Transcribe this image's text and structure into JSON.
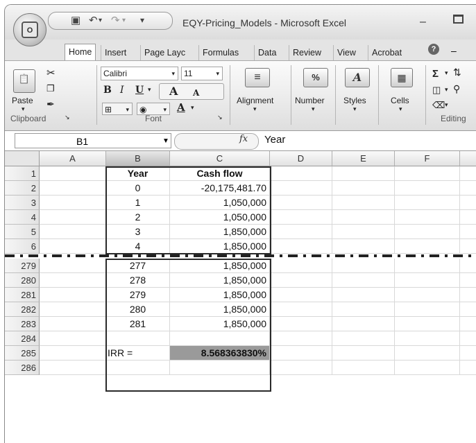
{
  "window": {
    "title": "EQY-Pricing_Models - Microsoft Excel",
    "office_logo_text": "O",
    "qat_icons": [
      "save-icon",
      "undo-icon",
      "redo-icon",
      "customize-icon"
    ]
  },
  "tabs": [
    "Home",
    "Insert",
    "Page Layc",
    "Formulas",
    "Data",
    "Review",
    "View",
    "Acrobat"
  ],
  "active_tab": "Home",
  "ribbon": {
    "paste_label": "Paste",
    "clipboard_label": "Clipboard",
    "font_name": "Calibri",
    "font_size": "11",
    "font_label": "Font",
    "alignment_label": "Alignment",
    "number_label": "Number",
    "styles_label": "Styles",
    "cells_label": "Cells",
    "editing_label": "Editing",
    "bold_label": "B",
    "italic_label": "I",
    "underline_label": "U",
    "grow_label": "A",
    "shrink_label": "A",
    "font_color_label": "A",
    "number_icon": "%",
    "sigma": "Σ"
  },
  "formula_bar": {
    "name_box": "B1",
    "fx": "fx",
    "value": "Year"
  },
  "columns": [
    "A",
    "B",
    "C",
    "D",
    "E",
    "F"
  ],
  "rows": [
    {
      "num": "1",
      "b": "Year",
      "c": "Cash flow"
    },
    {
      "num": "2",
      "b": "0",
      "c": "-20,175,481.70"
    },
    {
      "num": "3",
      "b": "1",
      "c": "1,050,000"
    },
    {
      "num": "4",
      "b": "2",
      "c": "1,050,000"
    },
    {
      "num": "5",
      "b": "3",
      "c": "1,850,000"
    },
    {
      "num": "6",
      "b": "4",
      "c": "1,850,000"
    },
    {
      "num": "279",
      "b": "277",
      "c": "1,850,000"
    },
    {
      "num": "280",
      "b": "278",
      "c": "1,850,000"
    },
    {
      "num": "281",
      "b": "279",
      "c": "1,850,000"
    },
    {
      "num": "282",
      "b": "280",
      "c": "1,850,000"
    },
    {
      "num": "283",
      "b": "281",
      "c": "1,850,000"
    },
    {
      "num": "284",
      "b": "",
      "c": ""
    },
    {
      "num": "285",
      "b": "IRR =",
      "c": "8.568363830%"
    },
    {
      "num": "286",
      "b": "",
      "c": ""
    }
  ]
}
